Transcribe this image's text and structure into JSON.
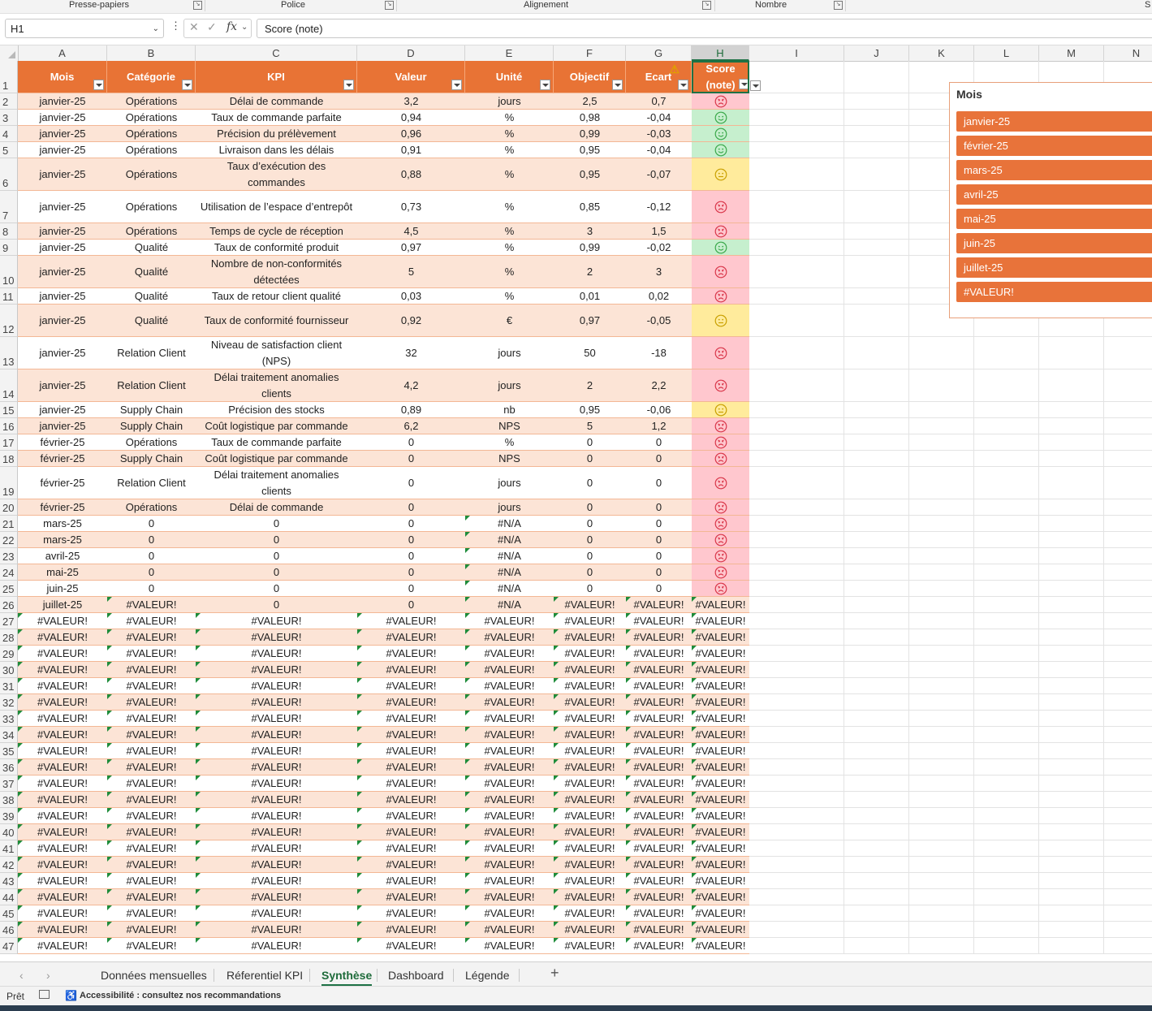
{
  "ribbon": {
    "groups": [
      "Presse-papiers",
      "Police",
      "Alignement",
      "Nombre",
      "S"
    ]
  },
  "formula_bar": {
    "name_box": "H1",
    "formula": "Score (note)",
    "fx": "fx",
    "more": "⋮"
  },
  "columns": [
    "A",
    "B",
    "C",
    "D",
    "E",
    "F",
    "G",
    "H",
    "I",
    "J",
    "K",
    "L",
    "M",
    "N"
  ],
  "headers": {
    "mois": "Mois",
    "categorie": "Catégorie",
    "kpi": "KPI",
    "valeur": "Valeur",
    "unite": "Unité",
    "objectif": "Objectif",
    "ecart": "Ecart",
    "score": "Score (note)"
  },
  "faces": {
    "good": "#3aa84a",
    "mid": "#c9a000",
    "bad": "#d9364a",
    "bg_good": "#c6efce",
    "bg_mid": "#ffeb9c",
    "bg_bad": "#ffc7ce"
  },
  "rows": [
    {
      "n": "2",
      "a": "janvier-25",
      "b": "Opérations",
      "c": "Délai de commande",
      "d": "3,2",
      "e": "jours",
      "f": "2,5",
      "g": "0,7",
      "s": "bad"
    },
    {
      "n": "3",
      "a": "janvier-25",
      "b": "Opérations",
      "c": "Taux de commande parfaite",
      "d": "0,94",
      "e": "%",
      "f": "0,98",
      "g": "-0,04",
      "s": "good"
    },
    {
      "n": "4",
      "a": "janvier-25",
      "b": "Opérations",
      "c": "Précision du prélèvement",
      "d": "0,96",
      "e": "%",
      "f": "0,99",
      "g": "-0,03",
      "s": "good"
    },
    {
      "n": "5",
      "a": "janvier-25",
      "b": "Opérations",
      "c": "Livraison dans les délais",
      "d": "0,91",
      "e": "%",
      "f": "0,95",
      "g": "-0,04",
      "s": "good"
    },
    {
      "n": "6",
      "a": "janvier-25",
      "b": "Opérations",
      "c": "Taux d’exécution des commandes",
      "d": "0,88",
      "e": "%",
      "f": "0,95",
      "g": "-0,07",
      "s": "mid"
    },
    {
      "n": "7",
      "a": "janvier-25",
      "b": "Opérations",
      "c": "Utilisation de l’espace d’entrepôt",
      "d": "0,73",
      "e": "%",
      "f": "0,85",
      "g": "-0,12",
      "s": "bad"
    },
    {
      "n": "8",
      "a": "janvier-25",
      "b": "Opérations",
      "c": "Temps de cycle de réception",
      "d": "4,5",
      "e": "%",
      "f": "3",
      "g": "1,5",
      "s": "bad"
    },
    {
      "n": "9",
      "a": "janvier-25",
      "b": "Qualité",
      "c": "Taux de conformité produit",
      "d": "0,97",
      "e": "%",
      "f": "0,99",
      "g": "-0,02",
      "s": "good"
    },
    {
      "n": "10",
      "a": "janvier-25",
      "b": "Qualité",
      "c": "Nombre de non-conformités détectées",
      "d": "5",
      "e": "%",
      "f": "2",
      "g": "3",
      "s": "bad"
    },
    {
      "n": "11",
      "a": "janvier-25",
      "b": "Qualité",
      "c": "Taux de retour client qualité",
      "d": "0,03",
      "e": "%",
      "f": "0,01",
      "g": "0,02",
      "s": "bad"
    },
    {
      "n": "12",
      "a": "janvier-25",
      "b": "Qualité",
      "c": "Taux de conformité fournisseur",
      "d": "0,92",
      "e": "€",
      "f": "0,97",
      "g": "-0,05",
      "s": "mid"
    },
    {
      "n": "13",
      "a": "janvier-25",
      "b": "Relation Client",
      "c": "Niveau de satisfaction client (NPS)",
      "d": "32",
      "e": "jours",
      "f": "50",
      "g": "-18",
      "s": "bad"
    },
    {
      "n": "14",
      "a": "janvier-25",
      "b": "Relation Client",
      "c": "Délai traitement anomalies clients",
      "d": "4,2",
      "e": "jours",
      "f": "2",
      "g": "2,2",
      "s": "bad"
    },
    {
      "n": "15",
      "a": "janvier-25",
      "b": "Supply Chain",
      "c": "Précision des stocks",
      "d": "0,89",
      "e": "nb",
      "f": "0,95",
      "g": "-0,06",
      "s": "mid"
    },
    {
      "n": "16",
      "a": "janvier-25",
      "b": "Supply Chain",
      "c": "Coût logistique par commande",
      "d": "6,2",
      "e": "NPS",
      "f": "5",
      "g": "1,2",
      "s": "bad"
    },
    {
      "n": "17",
      "a": "février-25",
      "b": "Opérations",
      "c": "Taux de commande parfaite",
      "d": "0",
      "e": "%",
      "f": "0",
      "g": "0",
      "s": "bad"
    },
    {
      "n": "18",
      "a": "février-25",
      "b": "Supply Chain",
      "c": "Coût logistique par commande",
      "d": "0",
      "e": "NPS",
      "f": "0",
      "g": "0",
      "s": "bad"
    },
    {
      "n": "19",
      "a": "février-25",
      "b": "Relation Client",
      "c": "Délai traitement anomalies clients",
      "d": "0",
      "e": "jours",
      "f": "0",
      "g": "0",
      "s": "bad"
    },
    {
      "n": "20",
      "a": "février-25",
      "b": "Opérations",
      "c": "Délai de commande",
      "d": "0",
      "e": "jours",
      "f": "0",
      "g": "0",
      "s": "bad"
    },
    {
      "n": "21",
      "a": "mars-25",
      "b": "0",
      "c": "0",
      "d": "0",
      "e": "#N/A",
      "f": "0",
      "g": "0",
      "s": "bad"
    },
    {
      "n": "22",
      "a": "mars-25",
      "b": "0",
      "c": "0",
      "d": "0",
      "e": "#N/A",
      "f": "0",
      "g": "0",
      "s": "bad"
    },
    {
      "n": "23",
      "a": "avril-25",
      "b": "0",
      "c": "0",
      "d": "0",
      "e": "#N/A",
      "f": "0",
      "g": "0",
      "s": "bad"
    },
    {
      "n": "24",
      "a": "mai-25",
      "b": "0",
      "c": "0",
      "d": "0",
      "e": "#N/A",
      "f": "0",
      "g": "0",
      "s": "bad"
    },
    {
      "n": "25",
      "a": "juin-25",
      "b": "0",
      "c": "0",
      "d": "0",
      "e": "#N/A",
      "f": "0",
      "g": "0",
      "s": "bad"
    },
    {
      "n": "26",
      "a": "juillet-25",
      "b": "#VALEUR!",
      "c": "0",
      "d": "0",
      "e": "#N/A",
      "f": "#VALEUR!",
      "g": "#VALEUR!",
      "s": "#VALEUR!"
    },
    {
      "n": "27",
      "a": "#VALEUR!",
      "b": "#VALEUR!",
      "c": "#VALEUR!",
      "d": "#VALEUR!",
      "e": "#VALEUR!",
      "f": "#VALEUR!",
      "g": "#VALEUR!",
      "s": "#VALEUR!"
    },
    {
      "n": "28",
      "a": "#VALEUR!",
      "b": "#VALEUR!",
      "c": "#VALEUR!",
      "d": "#VALEUR!",
      "e": "#VALEUR!",
      "f": "#VALEUR!",
      "g": "#VALEUR!",
      "s": "#VALEUR!"
    },
    {
      "n": "29",
      "a": "#VALEUR!",
      "b": "#VALEUR!",
      "c": "#VALEUR!",
      "d": "#VALEUR!",
      "e": "#VALEUR!",
      "f": "#VALEUR!",
      "g": "#VALEUR!",
      "s": "#VALEUR!"
    },
    {
      "n": "30",
      "a": "#VALEUR!",
      "b": "#VALEUR!",
      "c": "#VALEUR!",
      "d": "#VALEUR!",
      "e": "#VALEUR!",
      "f": "#VALEUR!",
      "g": "#VALEUR!",
      "s": "#VALEUR!"
    },
    {
      "n": "31",
      "a": "#VALEUR!",
      "b": "#VALEUR!",
      "c": "#VALEUR!",
      "d": "#VALEUR!",
      "e": "#VALEUR!",
      "f": "#VALEUR!",
      "g": "#VALEUR!",
      "s": "#VALEUR!"
    },
    {
      "n": "32",
      "a": "#VALEUR!",
      "b": "#VALEUR!",
      "c": "#VALEUR!",
      "d": "#VALEUR!",
      "e": "#VALEUR!",
      "f": "#VALEUR!",
      "g": "#VALEUR!",
      "s": "#VALEUR!"
    },
    {
      "n": "33",
      "a": "#VALEUR!",
      "b": "#VALEUR!",
      "c": "#VALEUR!",
      "d": "#VALEUR!",
      "e": "#VALEUR!",
      "f": "#VALEUR!",
      "g": "#VALEUR!",
      "s": "#VALEUR!"
    },
    {
      "n": "34",
      "a": "#VALEUR!",
      "b": "#VALEUR!",
      "c": "#VALEUR!",
      "d": "#VALEUR!",
      "e": "#VALEUR!",
      "f": "#VALEUR!",
      "g": "#VALEUR!",
      "s": "#VALEUR!"
    },
    {
      "n": "35",
      "a": "#VALEUR!",
      "b": "#VALEUR!",
      "c": "#VALEUR!",
      "d": "#VALEUR!",
      "e": "#VALEUR!",
      "f": "#VALEUR!",
      "g": "#VALEUR!",
      "s": "#VALEUR!"
    },
    {
      "n": "36",
      "a": "#VALEUR!",
      "b": "#VALEUR!",
      "c": "#VALEUR!",
      "d": "#VALEUR!",
      "e": "#VALEUR!",
      "f": "#VALEUR!",
      "g": "#VALEUR!",
      "s": "#VALEUR!"
    },
    {
      "n": "37",
      "a": "#VALEUR!",
      "b": "#VALEUR!",
      "c": "#VALEUR!",
      "d": "#VALEUR!",
      "e": "#VALEUR!",
      "f": "#VALEUR!",
      "g": "#VALEUR!",
      "s": "#VALEUR!"
    },
    {
      "n": "38",
      "a": "#VALEUR!",
      "b": "#VALEUR!",
      "c": "#VALEUR!",
      "d": "#VALEUR!",
      "e": "#VALEUR!",
      "f": "#VALEUR!",
      "g": "#VALEUR!",
      "s": "#VALEUR!"
    },
    {
      "n": "39",
      "a": "#VALEUR!",
      "b": "#VALEUR!",
      "c": "#VALEUR!",
      "d": "#VALEUR!",
      "e": "#VALEUR!",
      "f": "#VALEUR!",
      "g": "#VALEUR!",
      "s": "#VALEUR!"
    },
    {
      "n": "40",
      "a": "#VALEUR!",
      "b": "#VALEUR!",
      "c": "#VALEUR!",
      "d": "#VALEUR!",
      "e": "#VALEUR!",
      "f": "#VALEUR!",
      "g": "#VALEUR!",
      "s": "#VALEUR!"
    },
    {
      "n": "41",
      "a": "#VALEUR!",
      "b": "#VALEUR!",
      "c": "#VALEUR!",
      "d": "#VALEUR!",
      "e": "#VALEUR!",
      "f": "#VALEUR!",
      "g": "#VALEUR!",
      "s": "#VALEUR!"
    },
    {
      "n": "42",
      "a": "#VALEUR!",
      "b": "#VALEUR!",
      "c": "#VALEUR!",
      "d": "#VALEUR!",
      "e": "#VALEUR!",
      "f": "#VALEUR!",
      "g": "#VALEUR!",
      "s": "#VALEUR!"
    },
    {
      "n": "43",
      "a": "#VALEUR!",
      "b": "#VALEUR!",
      "c": "#VALEUR!",
      "d": "#VALEUR!",
      "e": "#VALEUR!",
      "f": "#VALEUR!",
      "g": "#VALEUR!",
      "s": "#VALEUR!"
    },
    {
      "n": "44",
      "a": "#VALEUR!",
      "b": "#VALEUR!",
      "c": "#VALEUR!",
      "d": "#VALEUR!",
      "e": "#VALEUR!",
      "f": "#VALEUR!",
      "g": "#VALEUR!",
      "s": "#VALEUR!"
    },
    {
      "n": "45",
      "a": "#VALEUR!",
      "b": "#VALEUR!",
      "c": "#VALEUR!",
      "d": "#VALEUR!",
      "e": "#VALEUR!",
      "f": "#VALEUR!",
      "g": "#VALEUR!",
      "s": "#VALEUR!"
    },
    {
      "n": "46",
      "a": "#VALEUR!",
      "b": "#VALEUR!",
      "c": "#VALEUR!",
      "d": "#VALEUR!",
      "e": "#VALEUR!",
      "f": "#VALEUR!",
      "g": "#VALEUR!",
      "s": "#VALEUR!"
    },
    {
      "n": "47",
      "a": "#VALEUR!",
      "b": "#VALEUR!",
      "c": "#VALEUR!",
      "d": "#VALEUR!",
      "e": "#VALEUR!",
      "f": "#VALEUR!",
      "g": "#VALEUR!",
      "s": "#VALEUR!"
    }
  ],
  "slicer": {
    "title": "Mois",
    "items": [
      "janvier-25",
      "février-25",
      "mars-25",
      "avril-25",
      "mai-25",
      "juin-25",
      "juillet-25",
      "#VALEUR!"
    ]
  },
  "tabs": [
    "Données mensuelles",
    "Réferentiel KPI",
    "Synthèse",
    "Dashboard",
    "Légende"
  ],
  "active_tab": "Synthèse",
  "status": {
    "ready": "Prêt",
    "accessibility": "Accessibilité : consultez nos recommandations"
  },
  "colors": {
    "header_orange": "#e87335",
    "band_peach": "#fce4d6",
    "accent_green": "#1e7145"
  }
}
